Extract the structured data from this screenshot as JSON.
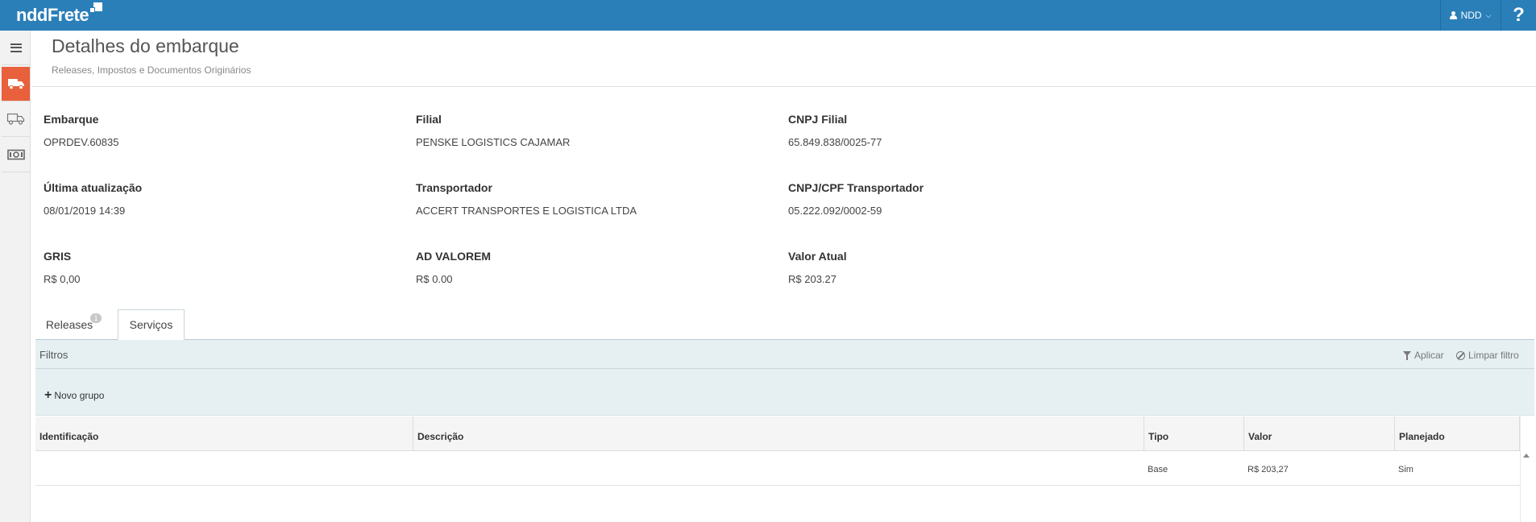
{
  "app": {
    "logo_text": "nddFrete",
    "user_name": "NDD",
    "help_label": "?"
  },
  "header": {
    "title": "Detalhes do embarque",
    "subtitle": "Releases, Impostos e Documentos Originários"
  },
  "fields": {
    "embarque": {
      "label": "Embarque",
      "value": "OPRDEV.60835"
    },
    "filial": {
      "label": "Filial",
      "value": "PENSKE LOGISTICS CAJAMAR"
    },
    "cnpj_filial": {
      "label": "CNPJ Filial",
      "value": "65.849.838/0025-77"
    },
    "ultima_atualizacao": {
      "label": "Última atualização",
      "value": "08/01/2019 14:39"
    },
    "transportador": {
      "label": "Transportador",
      "value": "ACCERT TRANSPORTES E LOGISTICA LTDA"
    },
    "cnpj_transportador": {
      "label": "CNPJ/CPF Transportador",
      "value": "05.222.092/0002-59"
    },
    "gris": {
      "label": "GRIS",
      "value": "R$ 0,00"
    },
    "ad_valorem": {
      "label": "AD VALOREM",
      "value": "R$ 0.00"
    },
    "valor_atual": {
      "label": "Valor Atual",
      "value": "R$ 203.27"
    }
  },
  "tabs": [
    {
      "label": "Releases",
      "badge": "1",
      "selected": false
    },
    {
      "label": "Serviços",
      "selected": true
    }
  ],
  "filters": {
    "title": "Filtros",
    "apply_label": "Aplicar",
    "clear_label": "Limpar filtro",
    "new_group_label": "Novo grupo"
  },
  "table": {
    "columns": [
      "Identificação",
      "Descrição",
      "Tipo",
      "Valor",
      "Planejado"
    ],
    "rows": [
      {
        "identificacao": "",
        "descricao": "",
        "tipo": "Base",
        "valor": "R$ 203,27",
        "planejado": "Sim"
      }
    ]
  },
  "colors": {
    "topbar": "#2a7fb8",
    "active_nav": "#e8603c",
    "filter_panel": "#e6f0f3"
  },
  "nav_icons": [
    "menu-icon",
    "truck-icon",
    "shipment-icon",
    "money-icon"
  ]
}
